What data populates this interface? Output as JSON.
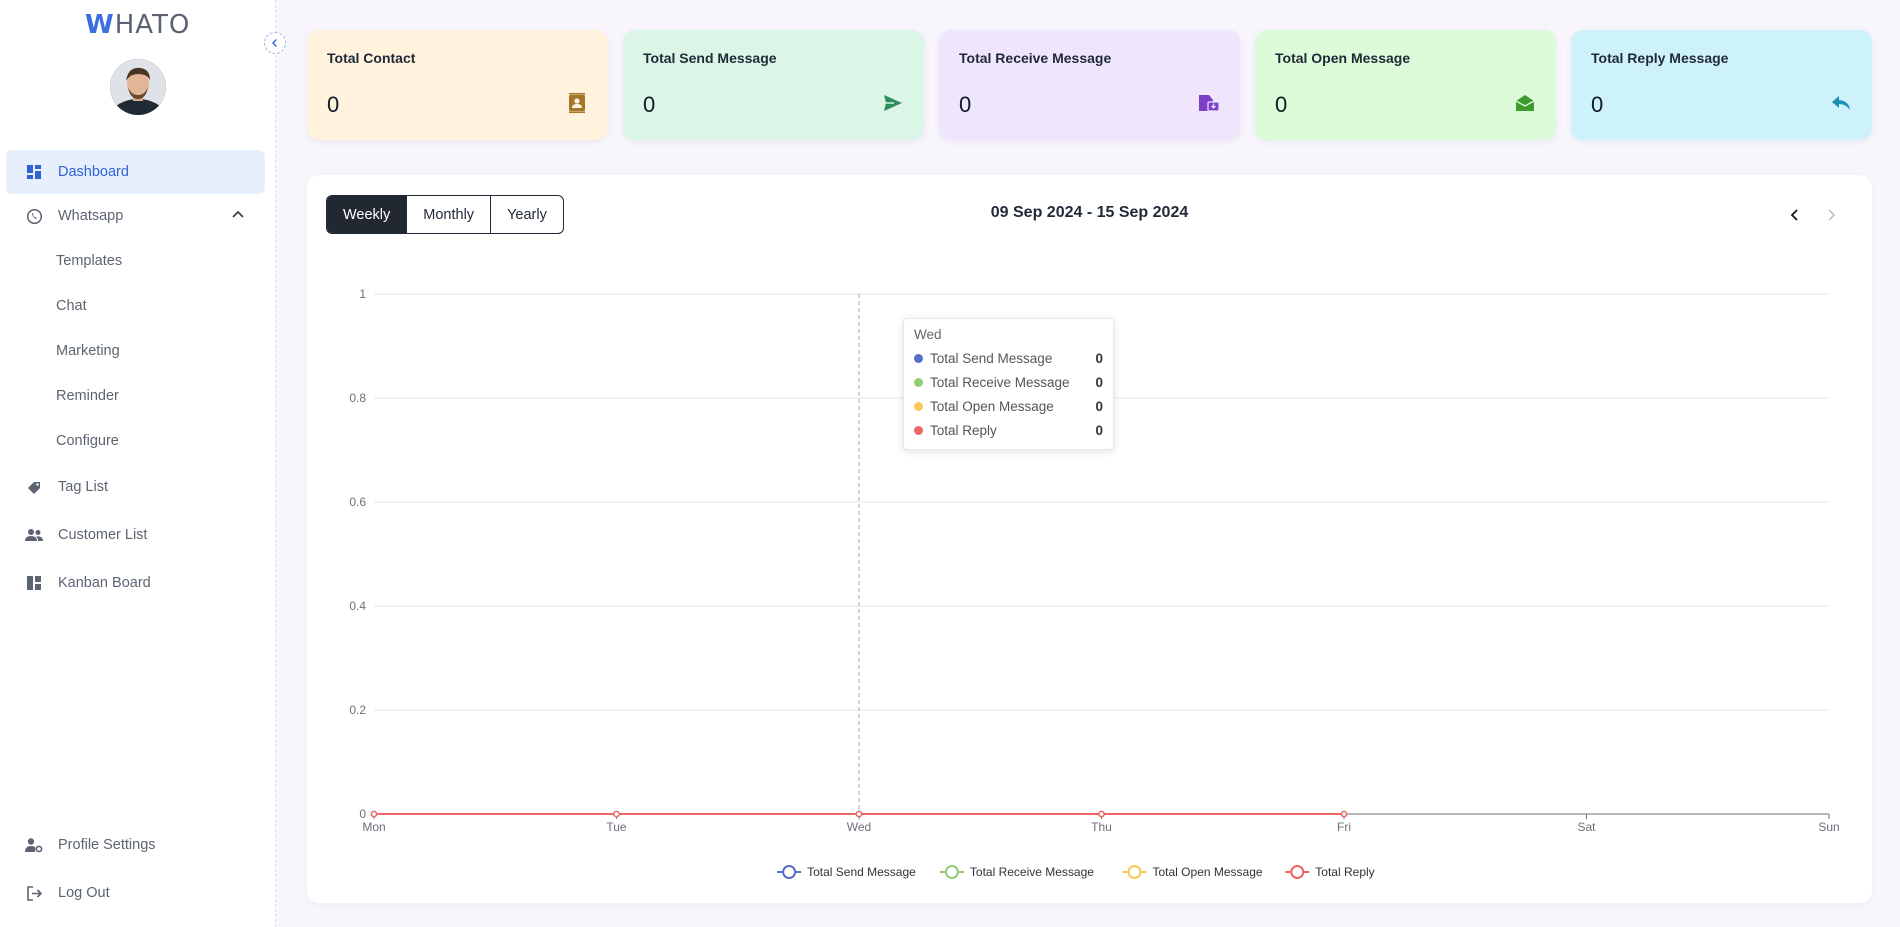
{
  "app": {
    "logo_first": "W",
    "logo_rest": "HATO"
  },
  "sidebar": {
    "items": [
      {
        "label": "Dashboard"
      },
      {
        "label": "Whatsapp"
      },
      {
        "label": "Templates"
      },
      {
        "label": "Chat"
      },
      {
        "label": "Marketing"
      },
      {
        "label": "Reminder"
      },
      {
        "label": "Configure"
      },
      {
        "label": "Tag List"
      },
      {
        "label": "Customer List"
      },
      {
        "label": "Kanban Board"
      }
    ],
    "bottom": [
      {
        "label": "Profile Settings"
      },
      {
        "label": "Log Out"
      }
    ]
  },
  "cards": [
    {
      "title": "Total Contact",
      "value": "0",
      "bg": "#fff3de",
      "icon_color": "#a5762a",
      "icon": "contact-book-icon"
    },
    {
      "title": "Total Send Message",
      "value": "0",
      "bg": "#dbf6e6",
      "icon_color": "#2f8f5b",
      "icon": "send-icon"
    },
    {
      "title": "Total Receive Message",
      "value": "0",
      "bg": "#efe5fd",
      "icon_color": "#7b3fc8",
      "icon": "inbox-receive-icon"
    },
    {
      "title": "Total Open Message",
      "value": "0",
      "bg": "#dcfbd8",
      "icon_color": "#3e9a2d",
      "icon": "open-envelope-icon"
    },
    {
      "title": "Total Reply Message",
      "value": "0",
      "bg": "#cdf2fb",
      "icon_color": "#1f8fb5",
      "icon": "reply-icon"
    }
  ],
  "filter": {
    "options": [
      "Weekly",
      "Monthly",
      "Yearly"
    ],
    "selected": "Weekly",
    "range": "09 Sep 2024 - 15 Sep 2024"
  },
  "tooltip": {
    "header": "Wed",
    "rows": [
      {
        "label": "Total Send Message",
        "value": "0",
        "color": "#5470c6"
      },
      {
        "label": "Total Receive Message",
        "value": "0",
        "color": "#91cc75"
      },
      {
        "label": "Total Open Message",
        "value": "0",
        "color": "#fac858"
      },
      {
        "label": "Total Reply",
        "value": "0",
        "color": "#ee6666"
      }
    ]
  },
  "chart_data": {
    "type": "line",
    "categories": [
      "Mon",
      "Tue",
      "Wed",
      "Thu",
      "Fri",
      "Sat",
      "Sun"
    ],
    "series": [
      {
        "name": "Total Send Message",
        "color": "#5470c6",
        "values": [
          0,
          0,
          0,
          0,
          0
        ]
      },
      {
        "name": "Total Receive Message",
        "color": "#91cc75",
        "values": [
          0,
          0,
          0,
          0,
          0
        ]
      },
      {
        "name": "Total Open Message",
        "color": "#fac858",
        "values": [
          0,
          0,
          0,
          0,
          0
        ]
      },
      {
        "name": "Total Reply",
        "color": "#ee6666",
        "values": [
          0,
          0,
          0,
          0,
          0
        ]
      }
    ],
    "y_ticks": [
      "0",
      "0.2",
      "0.4",
      "0.6",
      "0.8",
      "1"
    ],
    "ylim": [
      0,
      1
    ],
    "grid": true,
    "legend": "bottom-center",
    "highlight_category": "Wed"
  }
}
